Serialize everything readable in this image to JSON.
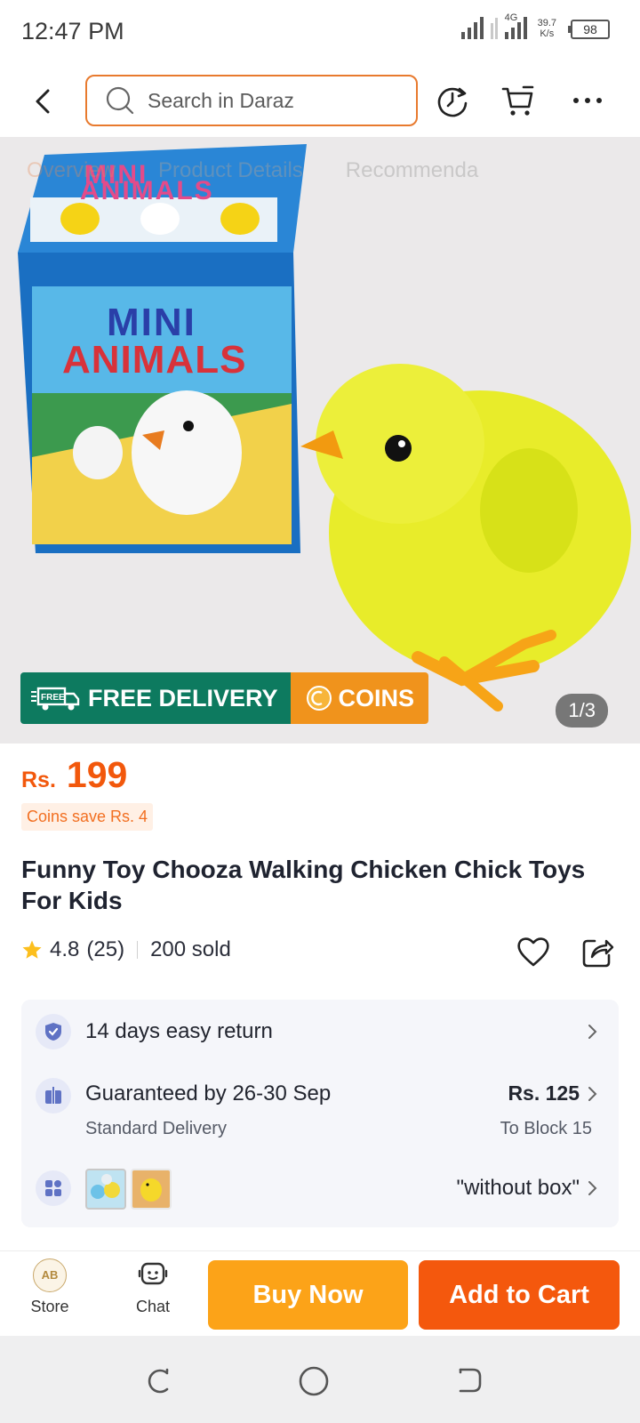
{
  "status_bar": {
    "time": "12:47 PM",
    "network_type": "4G",
    "speed_value": "39.7",
    "speed_unit": "K/s",
    "battery": "98"
  },
  "top_nav": {
    "search_placeholder": "Search in Daraz"
  },
  "hero": {
    "tabs": [
      "Overview",
      "Product Details",
      "Recommenda"
    ],
    "free_delivery_badge": "FREE DELIVERY",
    "free_icon_text": "FREE",
    "coins_badge": "COINS",
    "image_counter": "1/3",
    "box_text_1": "MINI",
    "box_text_2": "ANIMALS"
  },
  "product": {
    "currency": "Rs.",
    "price": "199",
    "coins_save": "Coins save Rs. 4",
    "title": "Funny Toy Chooza Walking Chicken Chick Toys For Kids",
    "rating": "4.8",
    "rating_count": "(25)",
    "sold": "200 sold"
  },
  "info_card": {
    "return_text": "14 days easy return",
    "delivery_text": "Guaranteed by 26-30 Sep",
    "delivery_sub": "Standard Delivery",
    "delivery_price": "Rs. 125",
    "delivery_location": "To Block 15",
    "variant_text": "\"without box\""
  },
  "action_bar": {
    "store_label": "Store",
    "store_logo_text": "AB",
    "chat_label": "Chat",
    "buy_now_label": "Buy Now",
    "add_to_cart_label": "Add to Cart"
  },
  "colors": {
    "brand_orange": "#f4580d",
    "buy_now": "#fca318",
    "free_delivery_green": "#0d7a5f",
    "price": "#f2580c"
  }
}
